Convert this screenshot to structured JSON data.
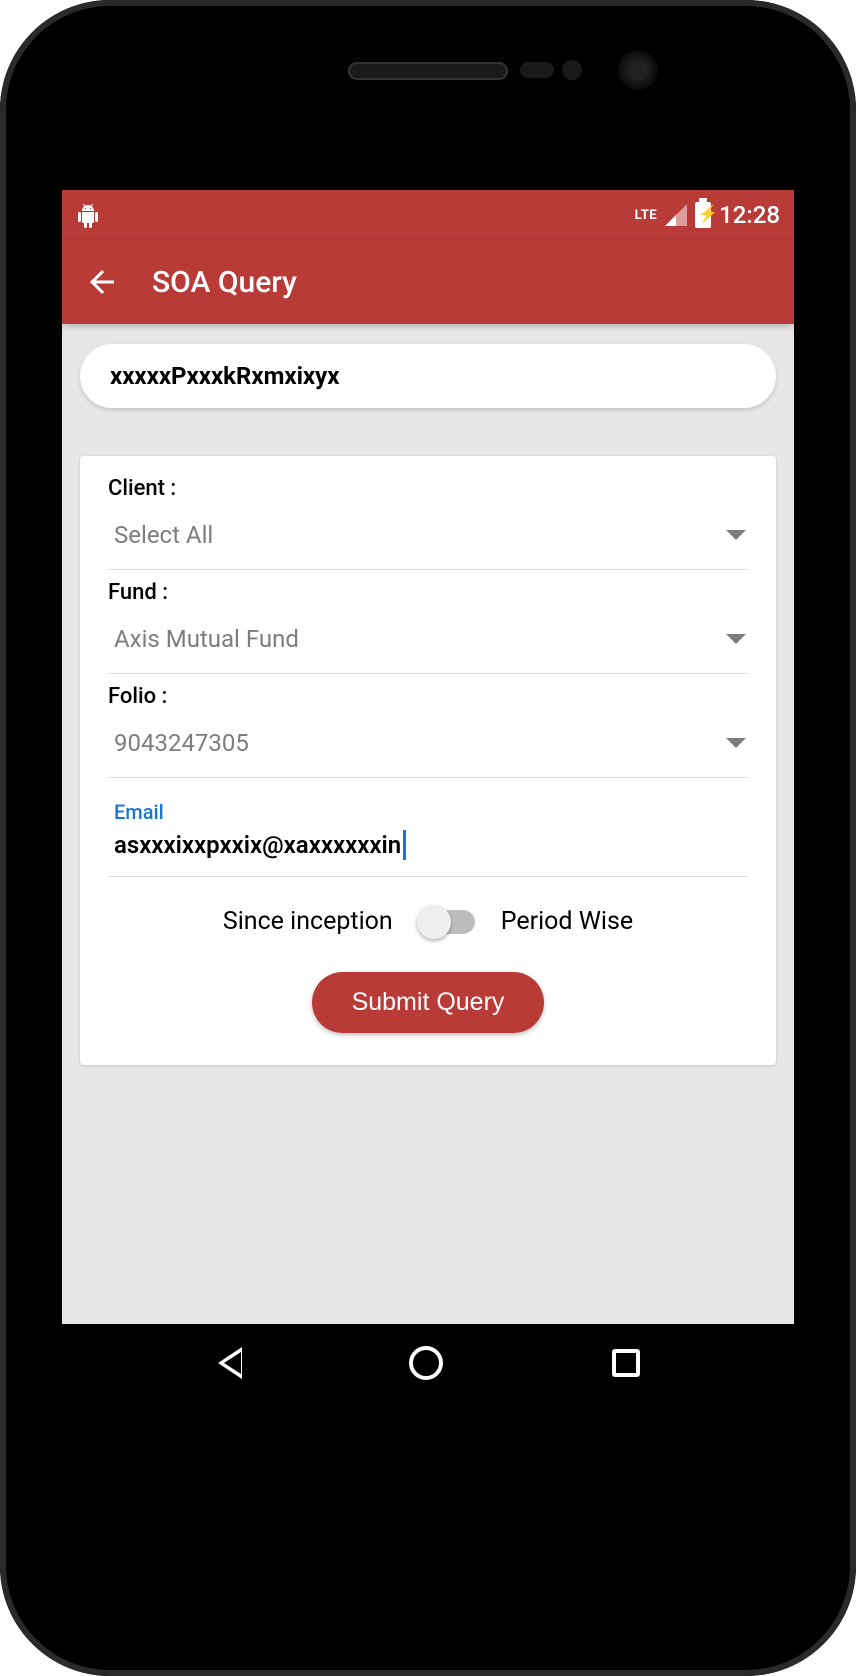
{
  "status_bar": {
    "network": "LTE",
    "time": "12:28"
  },
  "app_bar": {
    "title": "SOA Query"
  },
  "search": {
    "value": "xxxxxPxxxkRxmxixyx"
  },
  "form": {
    "client": {
      "label": "Client :",
      "value": "Select All"
    },
    "fund": {
      "label": "Fund :",
      "value": "Axis Mutual Fund"
    },
    "folio": {
      "label": "Folio :",
      "value": "9043247305"
    },
    "email": {
      "label": "Email",
      "value": "asxxxixxpxxix@xaxxxxxxin"
    },
    "toggle": {
      "left_label": "Since inception",
      "right_label": "Period Wise",
      "state": "since_inception"
    },
    "submit_label": "Submit Query"
  }
}
